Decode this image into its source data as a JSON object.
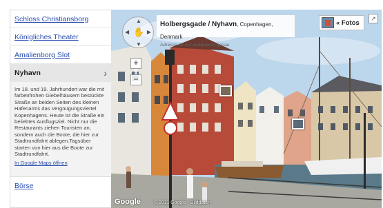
{
  "sidebar": {
    "items": [
      {
        "label": "Schloss Christiansborg"
      },
      {
        "label": "Königliches Theater"
      },
      {
        "label": "Amalienborg Slot"
      }
    ],
    "active": {
      "label": "Nyhavn",
      "description": "Im 18. und 19. Jahrhundert war die mit farbenfrohen Giebelhäusern bestückte Straße an beiden Seiten des kleinen Hafenarms das Vergnügungsviertel Kopenhagens. Heute ist die Straße ein beliebtes Ausflugsziel. Nicht nur die Restaurants ziehen Touristen an, sondern auch die Boote, die hier zur Stadtrundfahrt ablegen.Tagsüber starten von hier aus die Boote zur Stadtrundfahrt.",
      "link": "In Google Maps öffnen"
    },
    "last_item": {
      "label": "Börse"
    }
  },
  "viewer": {
    "street": "Holbergsgade / Nyhavn",
    "city": ", Copenhagen, Denmark",
    "approx": "Adresse ist nur annähernd genau",
    "fotos_label": "« Fotos",
    "logo": "Google",
    "copyright": "© 2011 Google · Bilddaten"
  },
  "colors": {
    "link": "#2a4fb0",
    "active_bg": "#e6e6e6",
    "sky": "#b8d4ea"
  }
}
